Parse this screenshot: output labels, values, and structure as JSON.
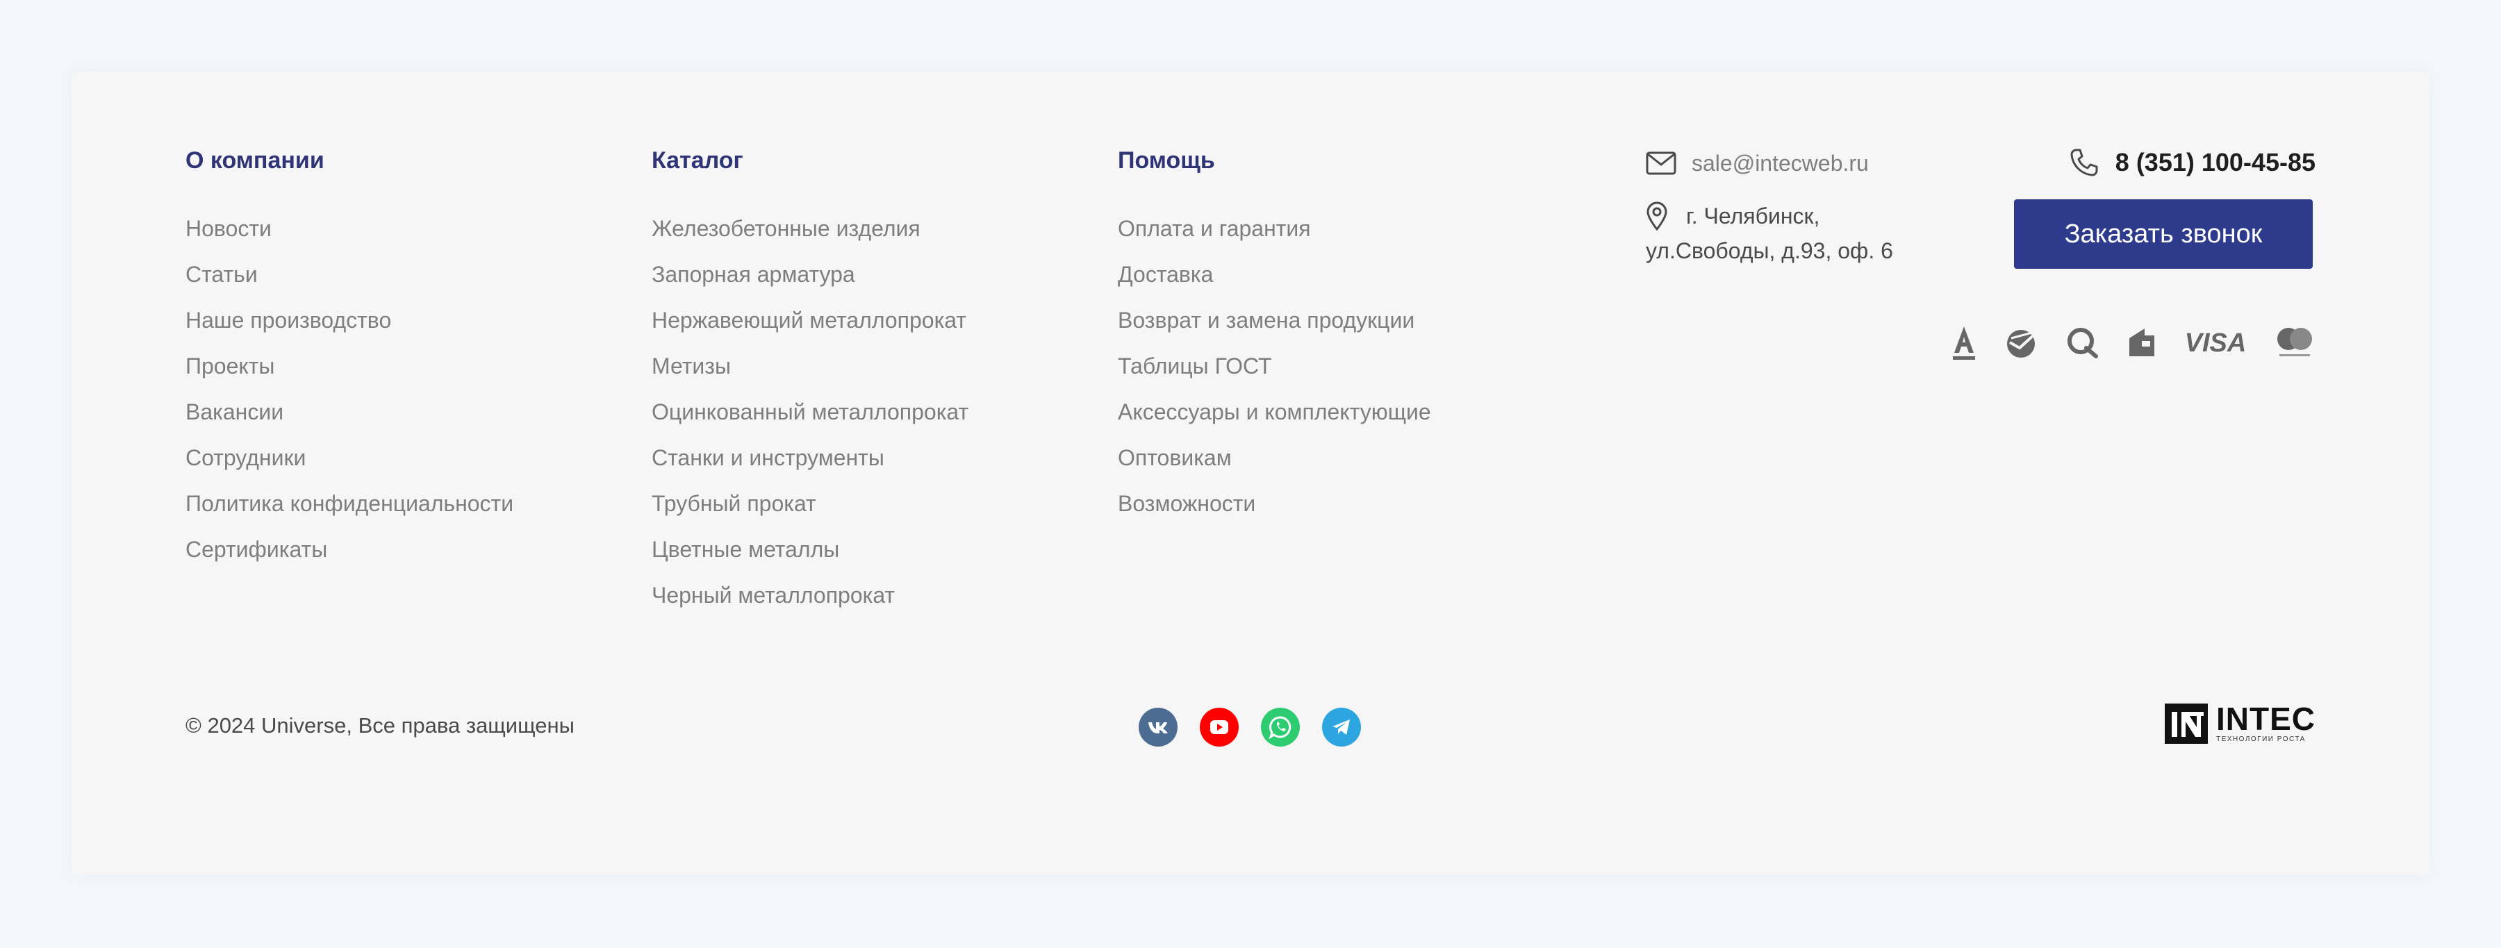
{
  "columns": [
    {
      "title": "О компании",
      "items": [
        "Новости",
        "Статьи",
        "Наше производство",
        "Проекты",
        "Вакансии",
        "Сотрудники",
        "Политика конфиденциальности",
        "Сертификаты"
      ]
    },
    {
      "title": "Каталог",
      "items": [
        "Железобетонные изделия",
        "Запорная арматура",
        "Нержавеющий металлопрокат",
        "Метизы",
        "Оцинкованный металлопрокат",
        "Станки и инструменты",
        "Трубный прокат",
        "Цветные металлы",
        "Черный металлопрокат"
      ]
    },
    {
      "title": "Помощь",
      "items": [
        "Оплата и гарантия",
        "Доставка",
        "Возврат и замена продукции",
        "Таблицы ГОСТ",
        "Аксессуары и комплектующие",
        "Оптовикам",
        "Возможности"
      ]
    }
  ],
  "contacts": {
    "email": "sale@intecweb.ru",
    "address_line1": "г. Челябинск,",
    "address_line2": "ул.Свободы, д.93, оф. 6",
    "phone": "8 (351) 100-45-85",
    "callback_label": "Заказать звонок",
    "email_icon": "envelope-icon",
    "address_icon": "map-pin-icon",
    "phone_icon": "phone-icon"
  },
  "payment_methods": [
    "alfa-bank-icon",
    "sberbank-icon",
    "qiwi-icon",
    "yoomoney-icon",
    "visa-icon",
    "mastercard-icon"
  ],
  "payment_labels": {
    "visa": "VISA"
  },
  "footer": {
    "copyright": "© 2024 Universe, Все права защищены"
  },
  "socials": [
    {
      "name": "vk",
      "color": "#4c6c91"
    },
    {
      "name": "youtube",
      "color": "#ff0000"
    },
    {
      "name": "whatsapp",
      "color": "#2ecc71"
    },
    {
      "name": "telegram",
      "color": "#2ca5e0"
    }
  ],
  "brand": {
    "name": "INTEC",
    "tagline": "ТЕХНОЛОГИИ РОСТА"
  },
  "colors": {
    "accent": "#2e3b8c",
    "heading": "#2e3476",
    "link": "#7e7e7e"
  }
}
